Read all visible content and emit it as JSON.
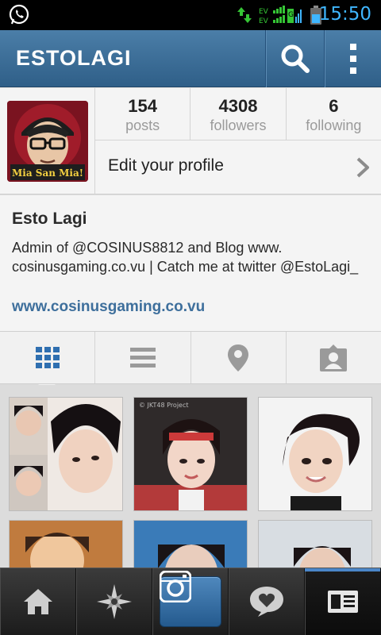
{
  "status_bar": {
    "time": "15:50",
    "network_labels": [
      "EV",
      "EV",
      "EV"
    ]
  },
  "action_bar": {
    "title": "ESTOLAGI",
    "icons": {
      "search": "search-icon",
      "menu": "overflow-menu-icon"
    },
    "color": "#3b6e98"
  },
  "profile": {
    "avatar_caption": "Mia San Mia!",
    "stats": [
      {
        "value": "154",
        "label": "posts"
      },
      {
        "value": "4308",
        "label": "followers"
      },
      {
        "value": "6",
        "label": "following"
      }
    ],
    "edit_label": "Edit your profile"
  },
  "bio": {
    "name": "Esto Lagi",
    "description": "Admin of @COSINUS8812 and Blog www. cosinusgaming.co.vu | Catch me at twitter @EstoLagi_",
    "website": "www.cosinusgaming.co.vu",
    "link_color": "#3e6f9c"
  },
  "view_tabs": [
    {
      "name": "grid-view",
      "icon": "grid-icon",
      "selected": true
    },
    {
      "name": "list-view",
      "icon": "list-icon",
      "selected": false
    },
    {
      "name": "map-view",
      "icon": "location-pin-icon",
      "selected": false
    },
    {
      "name": "tagged-view",
      "icon": "tagged-person-icon",
      "selected": false
    }
  ],
  "photos": [
    {
      "id": "photo-1",
      "overlay_text": ""
    },
    {
      "id": "photo-2",
      "overlay_text": "© JKT48 Project"
    },
    {
      "id": "photo-3",
      "overlay_text": ""
    },
    {
      "id": "photo-4",
      "overlay_text": ""
    },
    {
      "id": "photo-5",
      "overlay_text": ""
    },
    {
      "id": "photo-6",
      "overlay_text": ""
    }
  ],
  "bottom_nav": [
    {
      "name": "home",
      "icon": "home-icon"
    },
    {
      "name": "explore",
      "icon": "explore-star-icon"
    },
    {
      "name": "camera",
      "icon": "camera-icon"
    },
    {
      "name": "activity",
      "icon": "heart-bubble-icon"
    },
    {
      "name": "profile",
      "icon": "profile-card-icon",
      "active": true
    }
  ]
}
